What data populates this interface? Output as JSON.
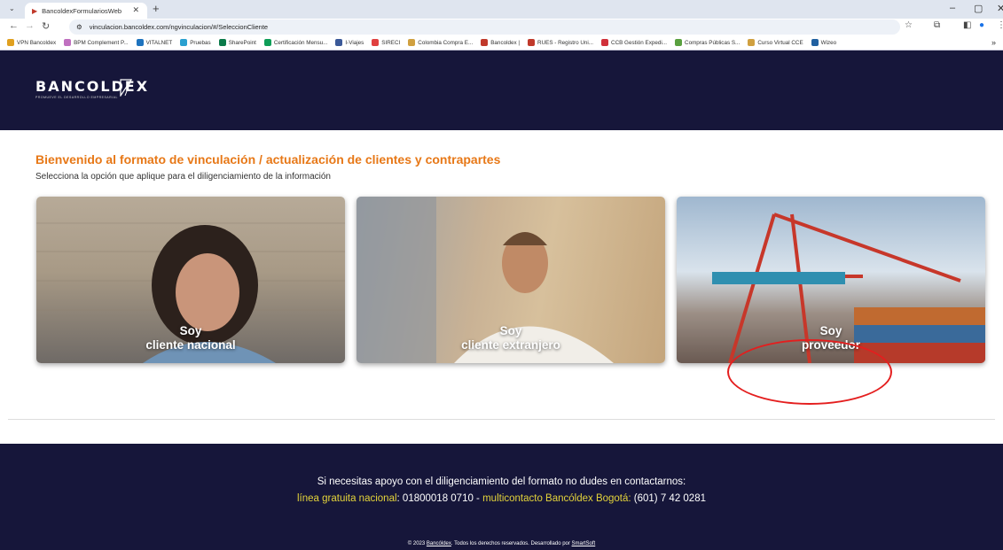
{
  "browser": {
    "tab_title": "BancoldexFormulariosWeb",
    "url": "vinculacion.bancoldex.com/ngvinculacion/#/SeleccionCliente"
  },
  "bookmarks": [
    "VPN Bancoldex",
    "BPM Complement P...",
    "VITALNET",
    "Pruebas",
    "SharePoint",
    "Certificación Mensu...",
    "I-Viajes",
    "SIRECI",
    "Colombia Compra E...",
    "Bancoldex |",
    "RUES - Registro Uni...",
    "CCB Gestión Expedi...",
    "Compras Públicas S...",
    "Curso Virtual CCE",
    "Wizeo"
  ],
  "bookmark_colors": [
    "#e0a020",
    "#c070c0",
    "#1e73be",
    "#2aa0d0",
    "#0a7a4a",
    "#0f9d58",
    "#3b5998",
    "#e04040",
    "#d0a040",
    "#c0392b",
    "#c0392b",
    "#d0303a",
    "#5aa040",
    "#d0a040",
    "#2060a0"
  ],
  "brand": {
    "name": "BANCOLDEX",
    "tagline": "PROMUEVE EL DESARROLLO EMPRESARIAL"
  },
  "page": {
    "title": "Bienvenido al formato de vinculación / actualización de clientes y contrapartes",
    "subtitle": "Selecciona la opción que aplique para el diligenciamiento de la información"
  },
  "options": [
    {
      "line1": "Soy",
      "line2": "cliente nacional"
    },
    {
      "line1": "Soy",
      "line2": "cliente extranjero"
    },
    {
      "line1": "Soy",
      "line2": "proveedor"
    }
  ],
  "footer": {
    "help": "Si necesitas apoyo con el diligenciamiento del formato no dudes en contactarnos:",
    "line_label": "línea gratuita nacional",
    "line_number": ": 01800018 0710 - ",
    "multi_label": "multicontacto Bancóldex Bogotá:",
    "multi_number": " (601) 7 42 0281",
    "copyright_pre": "© 2023 ",
    "copyright_link": "Bancóldex",
    "copyright_mid": ". Todos los derechos reservados. Desarrollado por ",
    "dev_link": "SmartSoft"
  },
  "colors": {
    "accent": "#e77817",
    "dark": "#16163a",
    "highlight": "#e41e1e",
    "footer_yellow": "#e3d33a"
  }
}
